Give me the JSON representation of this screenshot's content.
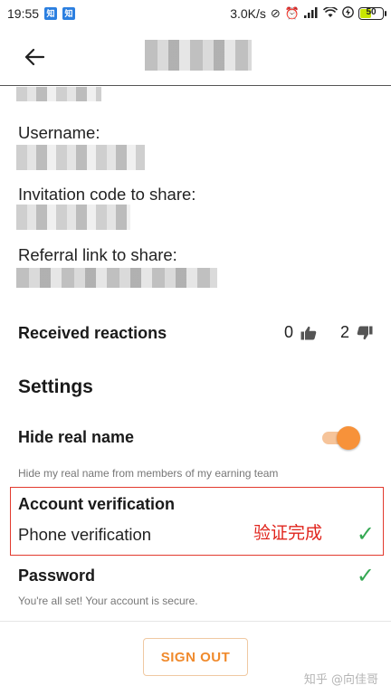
{
  "status_bar": {
    "time": "19:55",
    "notif_badge": "知",
    "network_speed": "3.0K/s",
    "icons": [
      "no-disturb-icon",
      "alarm-icon",
      "signal-icon",
      "wifi-icon",
      "charging-icon"
    ],
    "battery_level": "50",
    "battery_fraction": 0.5
  },
  "app_bar": {
    "back_icon": "arrow-left-icon"
  },
  "profile": {
    "username_label": "Username:",
    "invitation_label": "Invitation code to share:",
    "referral_label": "Referral link to share:"
  },
  "reactions": {
    "title": "Received reactions",
    "likes": "0",
    "dislikes": "2"
  },
  "settings": {
    "title": "Settings",
    "hide_real_name": {
      "title": "Hide real name",
      "helper": "Hide my real name from members of my earning team",
      "enabled": true
    },
    "account_verification": {
      "title": "Account verification",
      "phone_label": "Phone verification",
      "annotation": "验证完成",
      "check": "✓"
    },
    "password": {
      "title": "Password",
      "helper": "You're all set! Your account is secure.",
      "check": "✓"
    }
  },
  "footer": {
    "sign_out_label": "SIGN OUT",
    "watermark": "知乎 @向佳哥"
  },
  "colors": {
    "accent": "#f7923a",
    "check": "#35a853",
    "annotation_red": "#e0241c"
  }
}
